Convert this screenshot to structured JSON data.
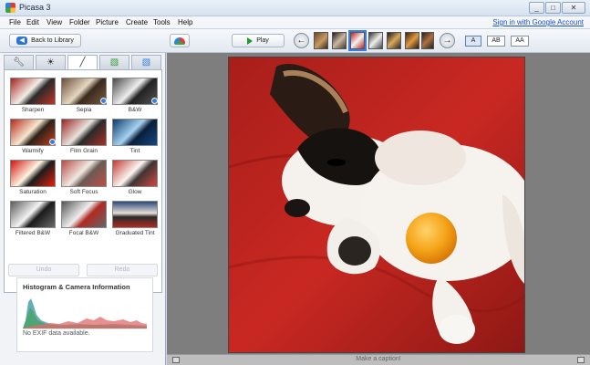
{
  "window": {
    "title": "Picasa 3",
    "controls": [
      "_",
      "□",
      "✕"
    ]
  },
  "menu": {
    "items": [
      "File",
      "Edit",
      "View",
      "Folder",
      "Picture",
      "Create",
      "Tools",
      "Help"
    ],
    "signin": "Sign in with Google Account"
  },
  "toolbar": {
    "back_label": "Back to Library",
    "play_label": "Play",
    "caption_sizes": [
      "A",
      "AB",
      "AA"
    ]
  },
  "tabs": [
    "basic-fixes",
    "tuning",
    "effects",
    "more-effects-1",
    "more-effects-2"
  ],
  "effects": [
    {
      "label": "Sharpen"
    },
    {
      "label": "Sepia"
    },
    {
      "label": "B&W"
    },
    {
      "label": "Warmify"
    },
    {
      "label": "Film Grain"
    },
    {
      "label": "Tint"
    },
    {
      "label": "Saturation"
    },
    {
      "label": "Soft Focus"
    },
    {
      "label": "Glow"
    },
    {
      "label": "Filtered B&W"
    },
    {
      "label": "Focal B&W"
    },
    {
      "label": "Graduated Tint"
    }
  ],
  "panel_buttons": {
    "undo": "Undo",
    "redo": "Redo"
  },
  "histogram": {
    "title": "Histogram & Camera Information",
    "exif_text": "No EXIF data available."
  },
  "viewer": {
    "caption_placeholder": "Make a caption!"
  },
  "colors": {
    "accent": "#3a7fe0",
    "play_green": "#1f9a2a",
    "signin_link": "#1a4fd0"
  }
}
